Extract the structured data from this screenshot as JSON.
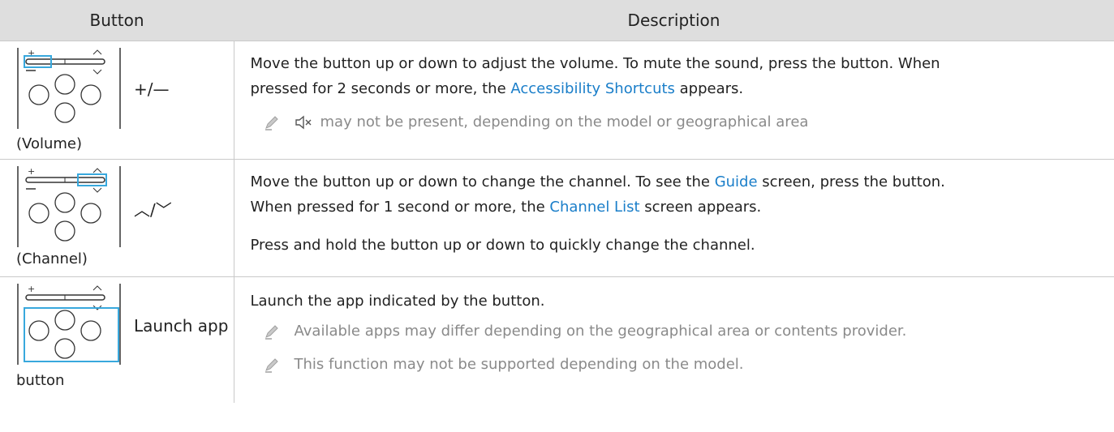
{
  "header": {
    "col_button": "Button",
    "col_description": "Description"
  },
  "rows": [
    {
      "label": "+/—",
      "caption": "(Volume)",
      "desc_1": "Move the button up or down to adjust the volume. To mute the sound, press the button. When",
      "desc_2_pre": "pressed for 2 seconds or more, the ",
      "desc_2_link": "Accessibility Shortcuts",
      "desc_2_post": " appears.",
      "note": "may not be present, depending on the model or geographical area"
    },
    {
      "label": "︿/﹀",
      "caption": "(Channel)",
      "desc_1_pre": "Move the button up or down to change the channel. To see the ",
      "desc_1_link": "Guide",
      "desc_1_post": " screen, press the button.",
      "desc_2_pre": "When pressed for 1 second or more, the ",
      "desc_2_link": "Channel List",
      "desc_2_post": " screen appears.",
      "desc_3": "Press and hold the button up or down to quickly change the channel."
    },
    {
      "label": "Launch app",
      "caption": "button",
      "desc_1": "Launch the app indicated by the button.",
      "note_1": "Available apps may differ depending on the geographical area or contents provider.",
      "note_2": "This function may not be supported depending on the model."
    }
  ],
  "colors": {
    "highlight": "#38a8dd",
    "link": "#1a7ec9",
    "header_bg": "#dedede",
    "note": "#8a8a8a"
  },
  "icons": [
    "remote-diagram-icon",
    "pencil-note-icon",
    "mute-icon"
  ]
}
